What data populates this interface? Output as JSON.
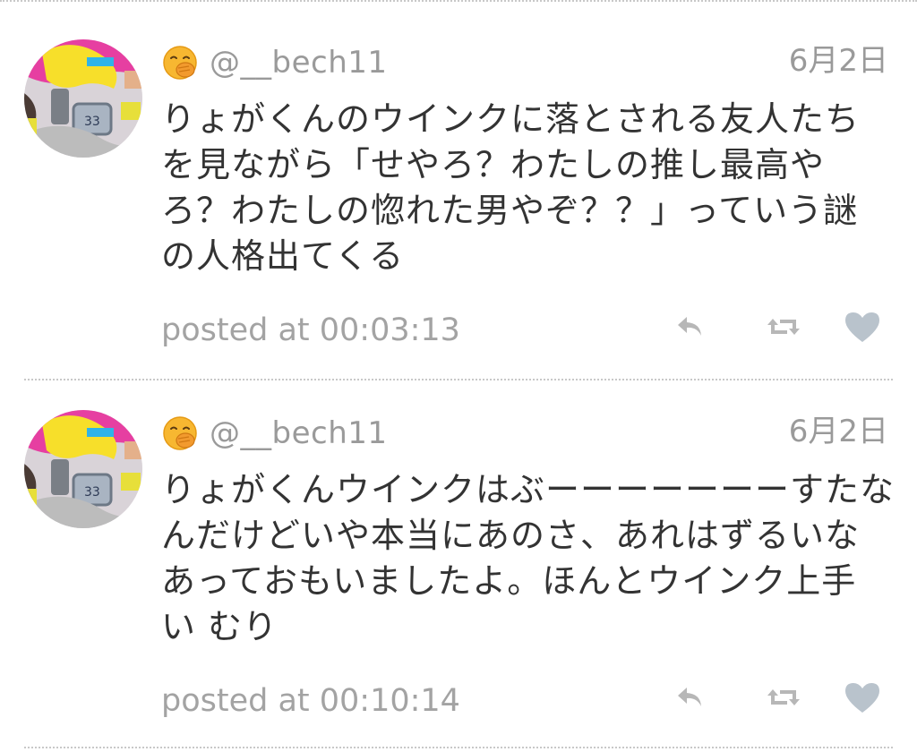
{
  "tweets": [
    {
      "handle": "@__bech11",
      "date": "6月2日",
      "text": "りょがくんのウインクに落とされる友人たち\nを見ながら「せやろ？わたしの推し最高や\nろ？わたしの惚れた男やぞ？？」っていう謎\nの人格出てくる",
      "posted": "posted at 00:03:13",
      "emoji_icon": "face-with-hand-over-mouth-icon",
      "actions": [
        "reply-icon",
        "retweet-icon",
        "heart-icon"
      ]
    },
    {
      "handle": "@__bech11",
      "date": "6月2日",
      "text": "りょがくんウインクはぶーーーーーーーすたな\nんだけどいや本当にあのさ、あれはずるいな\nあっておもいましたよ。ほんとウインク上手\nい むり",
      "posted": "posted at 00:10:14",
      "emoji_icon": "face-with-hand-over-mouth-icon",
      "actions": [
        "reply-icon",
        "retweet-icon",
        "heart-icon"
      ]
    }
  ],
  "colors": {
    "text": "#333333",
    "muted": "#9a9a9a",
    "icon": "#b7b7b7",
    "heart": "#b9c3cc",
    "divider": "#c8c8c8"
  }
}
